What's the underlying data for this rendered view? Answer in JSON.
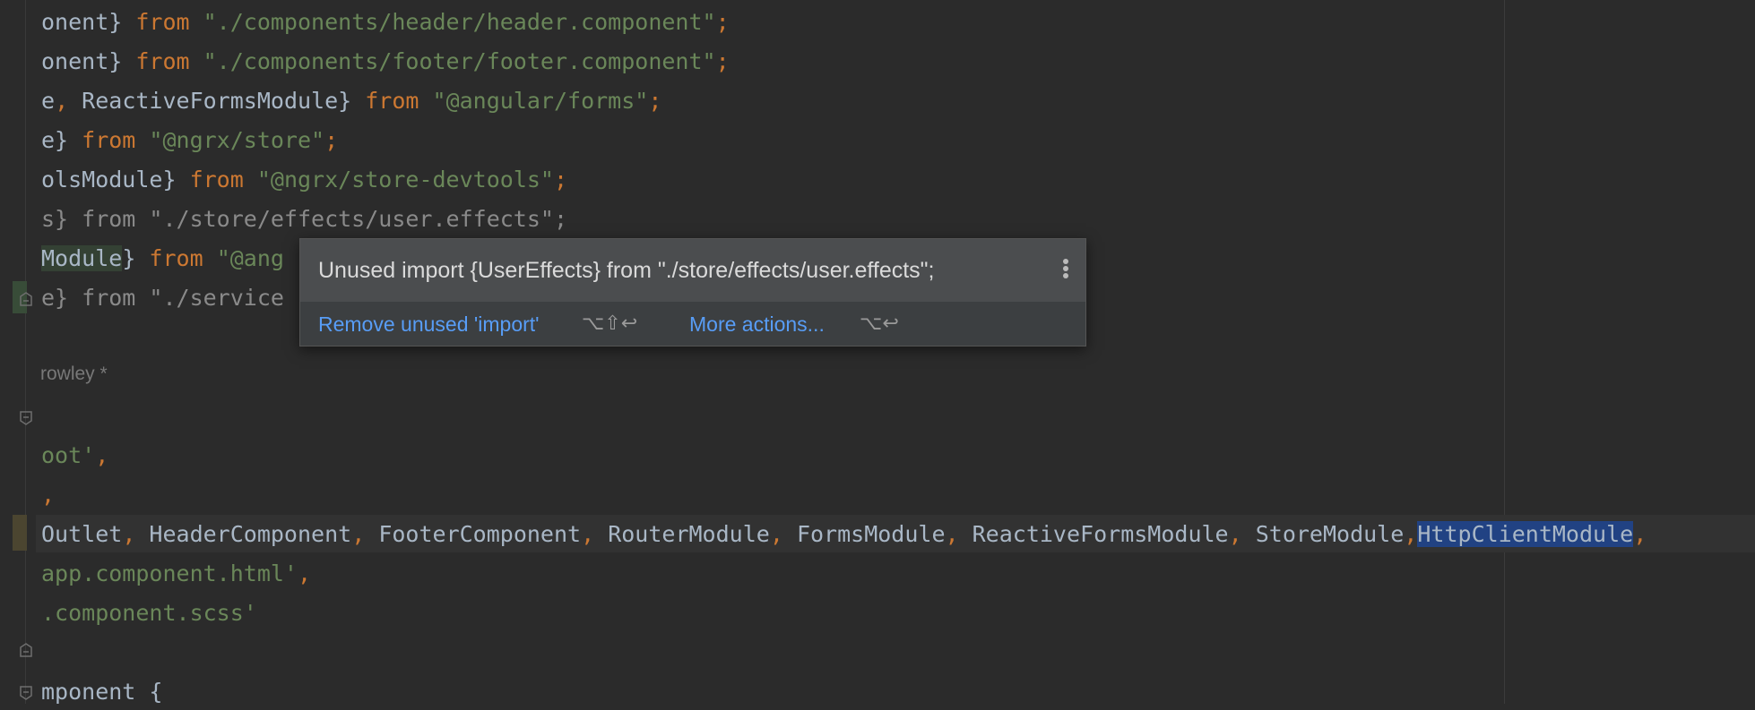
{
  "code_lines": [
    {
      "parts": [
        {
          "t": "onent} ",
          "c": "id"
        },
        {
          "t": "from ",
          "c": "kw"
        },
        {
          "t": "\"./components/header/header.component\"",
          "c": "str"
        },
        {
          "t": ";",
          "c": "kw"
        }
      ]
    },
    {
      "parts": [
        {
          "t": "onent} ",
          "c": "id"
        },
        {
          "t": "from ",
          "c": "kw"
        },
        {
          "t": "\"./components/footer/footer.component\"",
          "c": "str"
        },
        {
          "t": ";",
          "c": "kw"
        }
      ]
    },
    {
      "parts": [
        {
          "t": "e",
          "c": "id"
        },
        {
          "t": ", ",
          "c": "kw"
        },
        {
          "t": "ReactiveFormsModule} ",
          "c": "id"
        },
        {
          "t": "from ",
          "c": "kw"
        },
        {
          "t": "\"@angular/forms\"",
          "c": "str"
        },
        {
          "t": ";",
          "c": "kw"
        }
      ]
    },
    {
      "parts": [
        {
          "t": "e} ",
          "c": "id"
        },
        {
          "t": "from ",
          "c": "kw"
        },
        {
          "t": "\"@ngrx/store\"",
          "c": "str"
        },
        {
          "t": ";",
          "c": "kw"
        }
      ]
    },
    {
      "parts": [
        {
          "t": "olsModule} ",
          "c": "id"
        },
        {
          "t": "from ",
          "c": "kw"
        },
        {
          "t": "\"@ngrx/store-devtools\"",
          "c": "str"
        },
        {
          "t": ";",
          "c": "kw"
        }
      ]
    },
    {
      "parts": [
        {
          "t": "s} from \"./store/effects/user.effects\";",
          "c": "dim"
        }
      ]
    },
    {
      "parts": [
        {
          "t": "Module",
          "c": "id hl-ident"
        },
        {
          "t": "} ",
          "c": "id"
        },
        {
          "t": "from ",
          "c": "kw"
        },
        {
          "t": "\"@ang",
          "c": "str"
        }
      ]
    },
    {
      "parts": [
        {
          "t": "e} from \"./service",
          "c": "dim"
        }
      ]
    },
    {
      "parts": []
    },
    {
      "parts": []
    },
    {
      "parts": []
    },
    {
      "parts": [
        {
          "t": "oot'",
          "c": "str"
        },
        {
          "t": ",",
          "c": "kw"
        }
      ]
    },
    {
      "parts": [
        {
          "t": ",",
          "c": "kw"
        }
      ]
    },
    {
      "parts": [
        {
          "t": "Outlet",
          "c": "id"
        },
        {
          "t": ", ",
          "c": "kw"
        },
        {
          "t": "HeaderComponent",
          "c": "id"
        },
        {
          "t": ", ",
          "c": "kw"
        },
        {
          "t": "FooterComponent",
          "c": "id"
        },
        {
          "t": ", ",
          "c": "kw"
        },
        {
          "t": "RouterModule",
          "c": "id"
        },
        {
          "t": ", ",
          "c": "kw"
        },
        {
          "t": "FormsModule",
          "c": "id"
        },
        {
          "t": ", ",
          "c": "kw"
        },
        {
          "t": "ReactiveFormsModule",
          "c": "id"
        },
        {
          "t": ", ",
          "c": "kw"
        },
        {
          "t": "StoreModule",
          "c": "id"
        },
        {
          "t": ",",
          "c": "kw"
        },
        {
          "t": "HttpClientModule",
          "c": "id sel"
        },
        {
          "t": ",",
          "c": "kw"
        }
      ]
    },
    {
      "parts": [
        {
          "t": "app.component.html'",
          "c": "str"
        },
        {
          "t": ",",
          "c": "kw"
        }
      ]
    },
    {
      "parts": [
        {
          "t": ".component.scss'",
          "c": "str"
        }
      ]
    },
    {
      "parts": []
    },
    {
      "parts": [
        {
          "t": "mponent {",
          "c": "id"
        }
      ]
    }
  ],
  "author_hint": "rowley *",
  "popup": {
    "message": "Unused import {UserEffects} from \"./store/effects/user.effects\";",
    "primary_action": "Remove unused 'import'",
    "primary_shortcut": "⌥⇧↩",
    "more_actions": "More actions...",
    "more_shortcut": "⌥↩",
    "menu_icon": "more-vertical-icon"
  },
  "colors": {
    "background": "#2b2b2b",
    "keyword": "#cc7832",
    "string": "#6a8759",
    "identifier": "#a9b7c6",
    "unused": "#8a8a8a",
    "selection": "#214283",
    "link": "#589df6"
  }
}
